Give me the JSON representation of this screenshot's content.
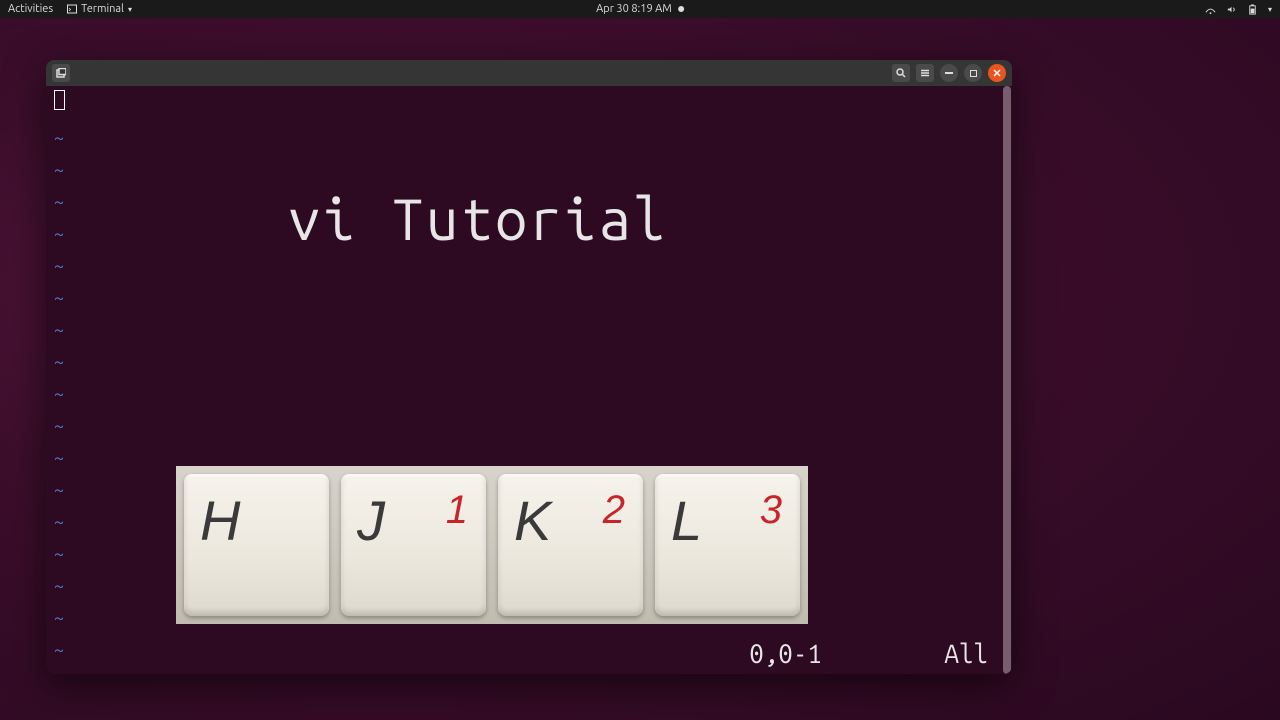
{
  "topbar": {
    "activities": "Activities",
    "app": "Terminal",
    "datetime": "Apr 30  8:19 AM"
  },
  "window": {
    "title_overlay": "vi Tutorial",
    "status_position": "0,0-1",
    "status_range": "All",
    "tilde": "~",
    "tilde_count": 17
  },
  "keys": [
    {
      "letter": "H",
      "num": ""
    },
    {
      "letter": "J",
      "num": "1"
    },
    {
      "letter": "K",
      "num": "2"
    },
    {
      "letter": "L",
      "num": "3"
    }
  ]
}
